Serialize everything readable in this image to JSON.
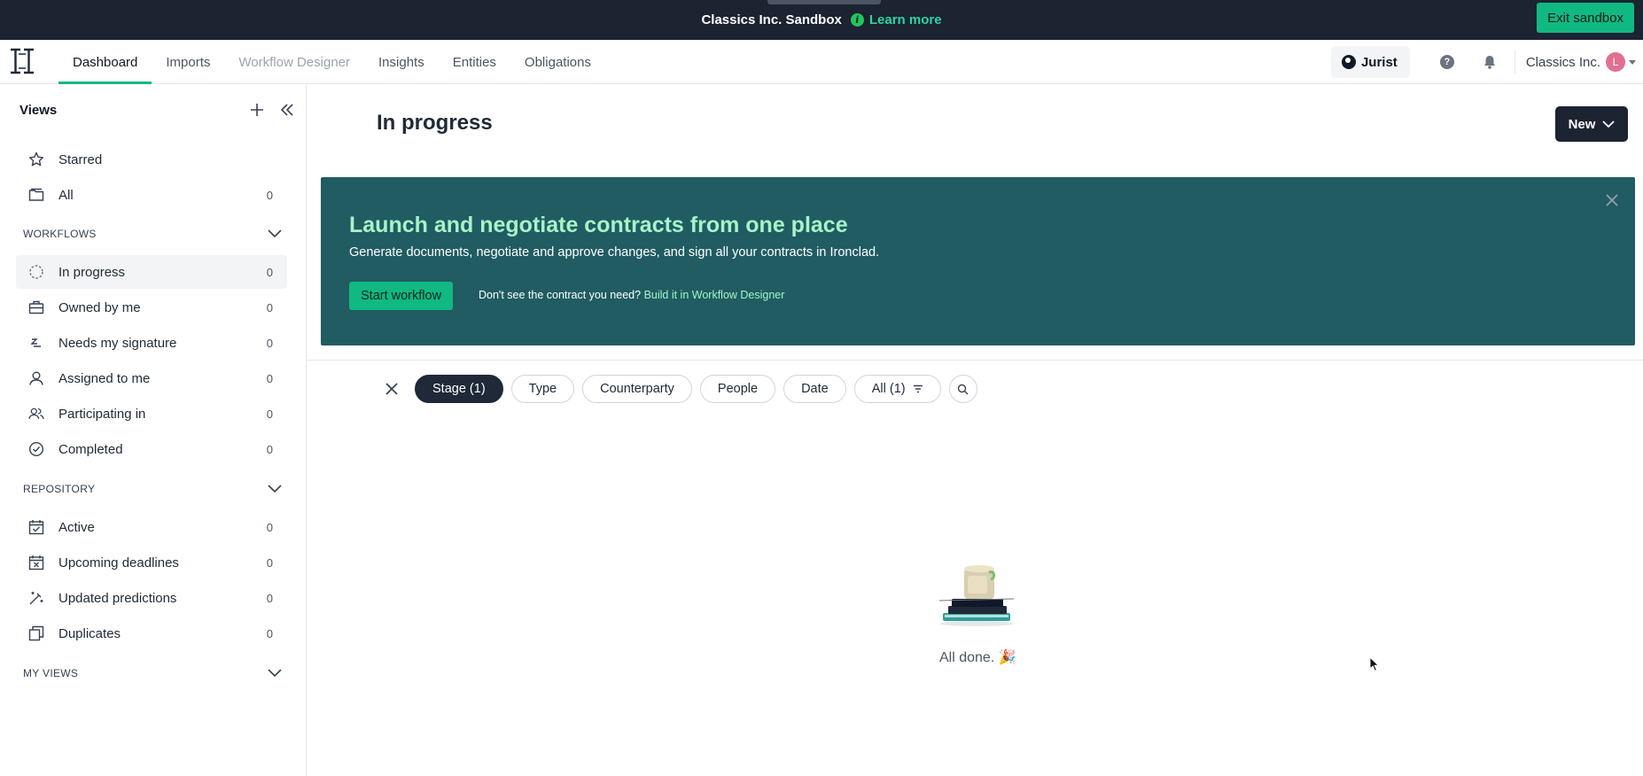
{
  "sandbox": {
    "title": "Classics Inc. Sandbox",
    "learn_more": "Learn more",
    "exit_label": "Exit sandbox"
  },
  "nav": {
    "tabs": [
      {
        "label": "Dashboard",
        "state": "active"
      },
      {
        "label": "Imports",
        "state": "normal"
      },
      {
        "label": "Workflow Designer",
        "state": "disabled"
      },
      {
        "label": "Insights",
        "state": "normal"
      },
      {
        "label": "Entities",
        "state": "normal"
      },
      {
        "label": "Obligations",
        "state": "normal"
      }
    ],
    "jurist_label": "Jurist",
    "org_name": "Classics Inc.",
    "avatar_initial": "L"
  },
  "sidebar": {
    "views_title": "Views",
    "top_items": [
      {
        "label": "Starred",
        "count": "",
        "icon": "star-icon"
      },
      {
        "label": "All",
        "count": "0",
        "icon": "folder-icon"
      }
    ],
    "workflows_header": "WORKFLOWS",
    "workflows": [
      {
        "label": "In progress",
        "count": "0",
        "icon": "dashed-circle-icon"
      },
      {
        "label": "Owned by me",
        "count": "0",
        "icon": "briefcase-icon"
      },
      {
        "label": "Needs my signature",
        "count": "0",
        "icon": "signature-icon"
      },
      {
        "label": "Assigned to me",
        "count": "0",
        "icon": "user-icon"
      },
      {
        "label": "Participating in",
        "count": "0",
        "icon": "users-icon"
      },
      {
        "label": "Completed",
        "count": "0",
        "icon": "check-circle-icon"
      }
    ],
    "repository_header": "REPOSITORY",
    "repository": [
      {
        "label": "Active",
        "count": "0",
        "icon": "calendar-check-icon"
      },
      {
        "label": "Upcoming deadlines",
        "count": "0",
        "icon": "calendar-x-icon"
      },
      {
        "label": "Updated predictions",
        "count": "0",
        "icon": "magic-wand-icon"
      },
      {
        "label": "Duplicates",
        "count": "0",
        "icon": "duplicate-icon"
      }
    ],
    "my_views_header": "MY VIEWS"
  },
  "main": {
    "title": "In progress",
    "new_label": "New",
    "banner": {
      "title": "Launch and negotiate contracts from one place",
      "subtitle": "Generate documents, negotiate and approve changes, and sign all your contracts in Ironclad.",
      "start_label": "Start workflow",
      "hint": "Don't see the contract you need?",
      "hint_link": "Build it in Workflow Designer"
    },
    "filters": [
      {
        "label": "Stage (1)",
        "active": true
      },
      {
        "label": "Type",
        "active": false
      },
      {
        "label": "Counterparty",
        "active": false
      },
      {
        "label": "People",
        "active": false
      },
      {
        "label": "Date",
        "active": false
      },
      {
        "label": "All (1)",
        "active": false
      }
    ],
    "empty_text": "All done. 🎉"
  },
  "colors": {
    "accent": "#10b981",
    "banner_bg": "#205c62",
    "banner_title": "#a7f3c8",
    "dark": "#1c2331"
  }
}
